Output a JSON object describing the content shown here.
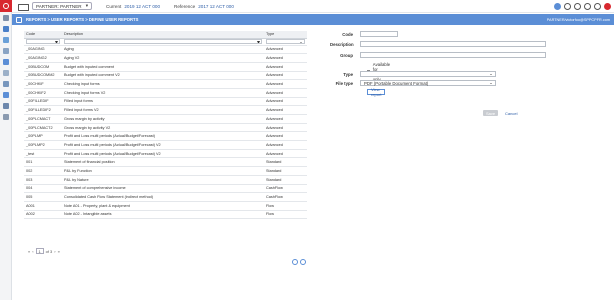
{
  "topbar": {
    "partner": "PARTNER: PARTNER",
    "current_label": "Current",
    "current_value": "2019 12 ACT 000",
    "reference_label": "Reference",
    "reference_value": "2017 12 ACT 000"
  },
  "header": {
    "breadcrumb": "REPORTS > USER REPORTS > DEFINE USER REPORTS",
    "user": "PARTNER/victorfoo@SPPCPFR.com"
  },
  "table": {
    "columns": [
      "Code",
      "Description",
      "Type"
    ],
    "rows": [
      {
        "code": "_00AGING",
        "desc": "Aging",
        "type": "Advanced"
      },
      {
        "code": "_00AGING2",
        "desc": "Aging V2",
        "type": "Advanced"
      },
      {
        "code": "_00BUDCOM",
        "desc": "Budget with inputed comment",
        "type": "Advanced"
      },
      {
        "code": "_00BUDCOMM2",
        "desc": "Budget with inputed comment V2",
        "type": "Advanced"
      },
      {
        "code": "_00CHKIF",
        "desc": "Checking input forms",
        "type": "Advanced"
      },
      {
        "code": "_00CHKIF2",
        "desc": "Checking input forms V2",
        "type": "Advanced"
      },
      {
        "code": "_00FILLEDIF",
        "desc": "Filled input forms",
        "type": "Advanced"
      },
      {
        "code": "_00FILLEDIF2",
        "desc": "Filled input forms V2",
        "type": "Advanced"
      },
      {
        "code": "_00PLCMACT",
        "desc": "Gross margin by activity",
        "type": "Advanced"
      },
      {
        "code": "_00PLCMACT2",
        "desc": "Gross margin by activity V2",
        "type": "Advanced"
      },
      {
        "code": "_00PLMP",
        "desc": "Profit and Loss multi periods (Actual/Budget/Forecast)",
        "type": "Advanced"
      },
      {
        "code": "_00PLMP2",
        "desc": "Profit and Loss multi periods (Actual/Budget/Forecast) V2",
        "type": "Advanced"
      },
      {
        "code": "_test",
        "desc": "Profit and Loss multi periods (Actual/Budget/Forecast) V2",
        "type": "Advanced"
      },
      {
        "code": "001",
        "desc": "Statement of financial position",
        "type": "Standard"
      },
      {
        "code": "002",
        "desc": "P&L by Function",
        "type": "Standard"
      },
      {
        "code": "003",
        "desc": "P&L by Nature",
        "type": "Standard"
      },
      {
        "code": "004",
        "desc": "Statement of comprehensive income",
        "type": "CashFlow"
      },
      {
        "code": "005",
        "desc": "Consolidated Cash Flow Statement (indirect method)",
        "type": "CashFlow"
      },
      {
        "code": "A001",
        "desc": "Note A01 - Property, plant & equipment",
        "type": "Flow"
      },
      {
        "code": "A002",
        "desc": "Note A02 - Intangible assets",
        "type": "Flow"
      }
    ],
    "pager": {
      "page": "1",
      "of": "of 3"
    }
  },
  "form": {
    "code_label": "Code",
    "description_label": "Description",
    "group_label": "Group",
    "available_label": "Available for system only",
    "type_label": "Type",
    "filetype_label": "File type",
    "filetype_value": "PDF (Portable Document Format)",
    "view_report": "View report",
    "save": "Save",
    "cancel": "Cancel"
  }
}
